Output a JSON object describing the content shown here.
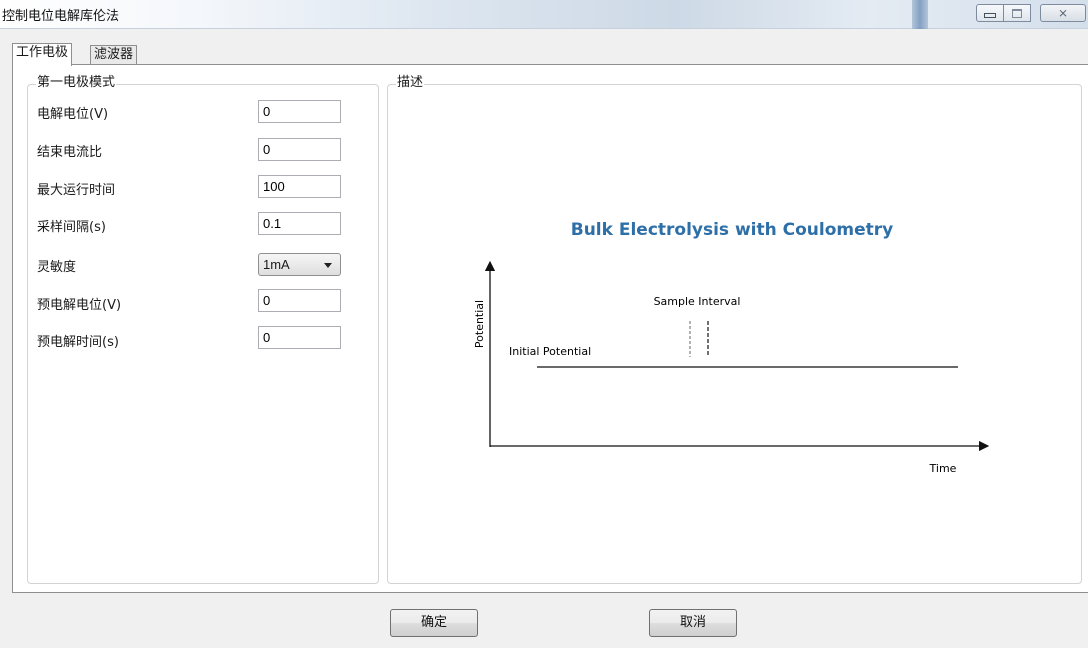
{
  "window": {
    "title": "控制电位电解库伦法",
    "controls": {
      "minimize_icon": "minimize-icon",
      "maximize_icon": "maximize-icon",
      "close_glyph": "⨯"
    }
  },
  "tabs": [
    {
      "label": "工作电极",
      "active": true
    },
    {
      "label": "滤波器",
      "active": false
    }
  ],
  "mode_group": {
    "legend": "第一电极模式",
    "fields": [
      {
        "label": "电解电位(V)",
        "value": "0"
      },
      {
        "label": "结束电流比",
        "value": "0"
      },
      {
        "label": "最大运行时间",
        "value": "100"
      },
      {
        "label": "采样间隔(s)",
        "value": "0.1"
      },
      {
        "label": "灵敏度",
        "value": "1mA",
        "type": "select"
      },
      {
        "label": "预电解电位(V)",
        "value": "0"
      },
      {
        "label": "预电解时间(s)",
        "value": "0"
      }
    ]
  },
  "description_group": {
    "legend": "描述",
    "diagram": {
      "title": "Bulk Electrolysis with Coulometry",
      "y_axis_label": "Potential",
      "x_axis_label": "Time",
      "initial_potential_label": "Initial Potential",
      "sample_interval_label": "Sample Interval",
      "title_color": "#2e6fa7"
    }
  },
  "buttons": {
    "ok": "确定",
    "cancel": "取消"
  }
}
